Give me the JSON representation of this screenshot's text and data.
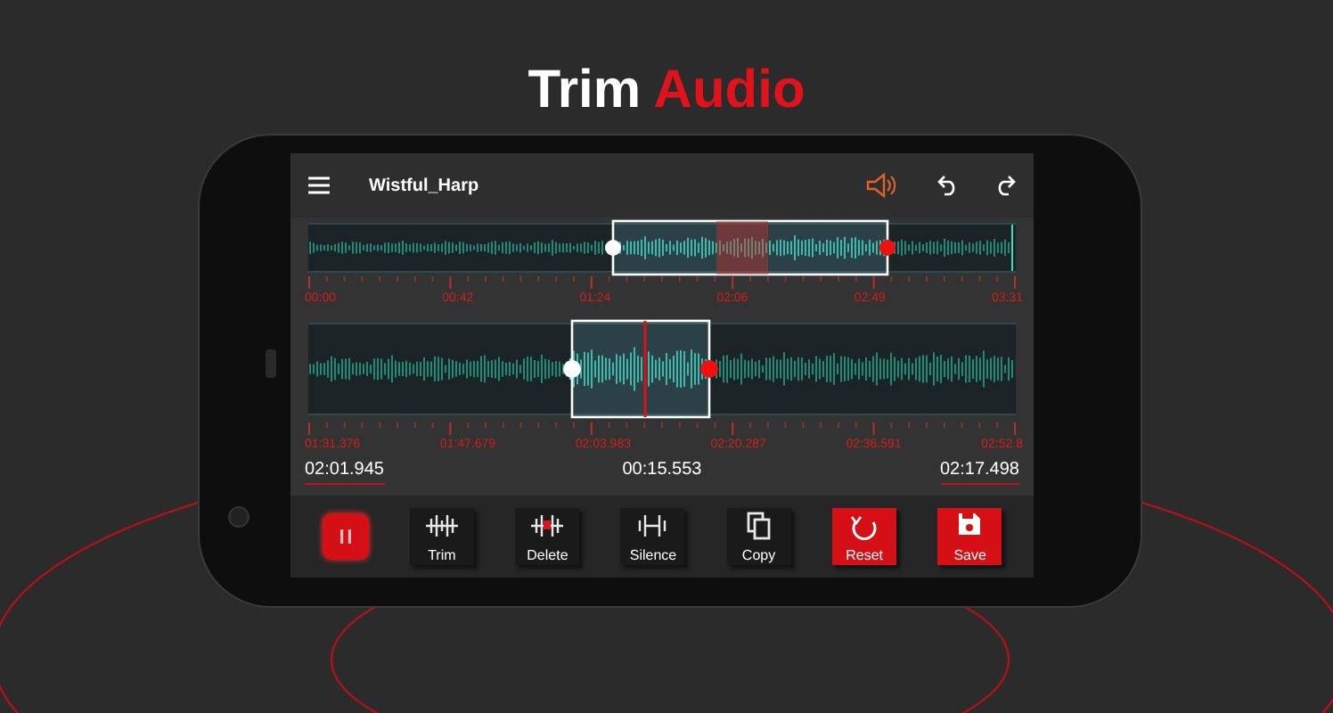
{
  "heading": {
    "text": "Trim",
    "accent": "Audio"
  },
  "app_bar": {
    "title": "Wistful_Harp"
  },
  "overview": {
    "tick_labels": [
      "00:00",
      "00:42",
      "01:24",
      "02:06",
      "02:49",
      "03:31"
    ]
  },
  "detail": {
    "tick_labels": [
      "01:31.376",
      "01:47.679",
      "02:03.983",
      "02:20.287",
      "02:36.591",
      "02:52.8"
    ]
  },
  "times": [
    {
      "text": "02:01.945",
      "marked": true
    },
    {
      "text": "00:15.553",
      "marked": false
    },
    {
      "text": "02:17.498",
      "marked": true
    }
  ],
  "toolbar": [
    {
      "kind": "pause"
    },
    {
      "kind": "trim",
      "label": "Trim"
    },
    {
      "kind": "delete",
      "label": "Delete"
    },
    {
      "kind": "silence",
      "label": "Silence"
    },
    {
      "kind": "copy",
      "label": "Copy"
    },
    {
      "kind": "reset",
      "label": "Reset"
    },
    {
      "kind": "save",
      "label": "Save"
    }
  ]
}
